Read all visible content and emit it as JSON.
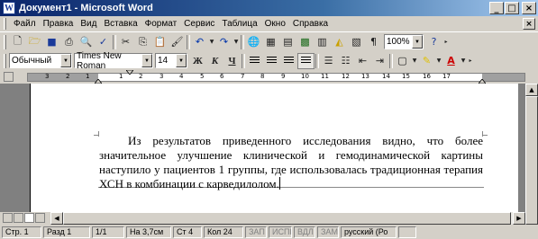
{
  "window": {
    "title": "Документ1 - Microsoft Word"
  },
  "menu": [
    {
      "label": "Файл"
    },
    {
      "label": "Правка"
    },
    {
      "label": "Вид"
    },
    {
      "label": "Вставка"
    },
    {
      "label": "Формат"
    },
    {
      "label": "Сервис"
    },
    {
      "label": "Таблица"
    },
    {
      "label": "Окно"
    },
    {
      "label": "Справка"
    }
  ],
  "toolbar_standard": {
    "zoom": "100%"
  },
  "toolbar_format": {
    "style": "Обычный",
    "font": "Times New Roman",
    "size": "14",
    "bold": "Ж",
    "italic": "К",
    "underline": "Ч",
    "font_color_glyph": "А"
  },
  "ruler": {
    "numbers": [
      "3",
      "2",
      "1",
      "1",
      "2",
      "3",
      "4",
      "5",
      "6",
      "7",
      "8",
      "9",
      "10",
      "11",
      "12",
      "13",
      "14",
      "15",
      "16",
      "17"
    ]
  },
  "document": {
    "text": "Из результатов приведенного исследования видно, что более значительное улучшение клинической и гемодинамической картины наступило у пациентов 1 группы, где использовалась традиционная терапия ХСН в комбинации с карведилолом."
  },
  "status": {
    "page": "Стр. 1",
    "section": "Разд 1",
    "pages": "1/1",
    "position": "На 3,7см",
    "line": "Ст 4",
    "column": "Кол 24",
    "rec": "ЗАП",
    "trk": "ИСПР",
    "ext": "ВДЛ",
    "ovr": "ЗАМ",
    "language": "русский (Ро"
  }
}
